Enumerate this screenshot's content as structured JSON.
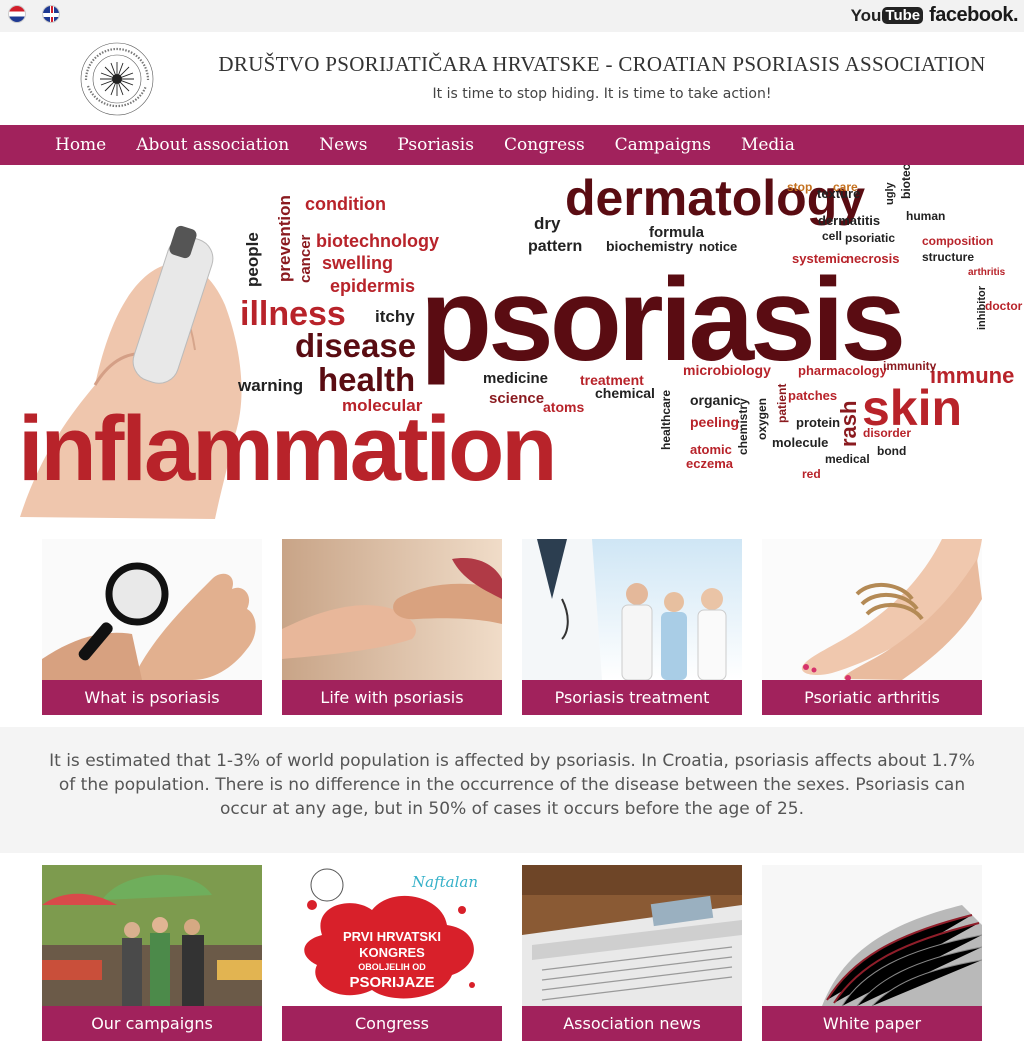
{
  "topbar": {
    "languages": [
      "Croatian",
      "English"
    ],
    "youtube_you": "You",
    "youtube_tube": "Tube",
    "facebook": "facebook."
  },
  "header": {
    "title": "DRUŠTVO PSORIJATIČARA HRVATSKE - CROATIAN PSORIASIS ASSOCIATION",
    "tagline": "It is time to stop hiding. It is time to take action!"
  },
  "nav": {
    "items": [
      "Home",
      "About association",
      "News",
      "Psoriasis",
      "Congress",
      "Campaigns",
      "Media"
    ]
  },
  "hero": {
    "words": {
      "dermatology": "dermatology",
      "psoriasis": "psoriasis",
      "inflammation": "inflammation",
      "skin": "skin",
      "health": "health",
      "disease": "disease",
      "illness": "illness",
      "condition": "condition",
      "biotechnology": "biotechnology",
      "swelling": "swelling",
      "epidermis": "epidermis",
      "itchy": "itchy",
      "warning": "warning",
      "molecular": "molecular",
      "people": "people",
      "prevention": "prevention",
      "cancer": "cancer",
      "dry": "dry",
      "pattern": "pattern",
      "formula": "formula",
      "biochemistry": "biochemistry",
      "notice": "notice",
      "stop": "stop",
      "care": "care",
      "texture": "texture",
      "dermatitis": "dermatitis",
      "cell": "cell",
      "psoriatic": "psoriatic",
      "ugly": "ugly",
      "biotech": "biotech",
      "human": "human",
      "composition": "composition",
      "structure": "structure",
      "systemic": "systemic",
      "necrosis": "necrosis",
      "arthritis": "arthritis",
      "inhibitor": "inhibitor",
      "doctor": "doctor",
      "medicine": "medicine",
      "science": "science",
      "treatment": "treatment",
      "chemical": "chemical",
      "atoms": "atoms",
      "healthcare": "healthcare",
      "microbiology": "microbiology",
      "pharmacology": "pharmacology",
      "immunity": "immunity",
      "immune": "immune",
      "organic": "organic",
      "peeling": "peeling",
      "chemistry": "chemistry",
      "oxygen": "oxygen",
      "patient": "patient",
      "patches": "patches",
      "protein": "protein",
      "molecule": "molecule",
      "rash": "rash",
      "disorder": "disorder",
      "bond": "bond",
      "atomic": "atomic",
      "eczema": "eczema",
      "medical": "medical",
      "red": "red"
    }
  },
  "cards_top": [
    {
      "label": "What is psoriasis"
    },
    {
      "label": "Life with psoriasis"
    },
    {
      "label": "Psoriasis treatment"
    },
    {
      "label": "Psoriatic arthritis"
    }
  ],
  "info": {
    "text": "It is estimated that 1-3% of world population is affected by psoriasis. In Croatia, psoriasis affects about 1.7% of the population. There is no difference in the occurrence of the disease between the sexes. Psoriasis can occur at any age, but in 50% of cases it occurs before the age of 25."
  },
  "cards_bottom": [
    {
      "label": "Our campaigns"
    },
    {
      "label": "Congress",
      "image_text_1": "PRVI HRVATSKI",
      "image_text_2": "KONGRES",
      "image_text_3": "OBOLJELIH OD",
      "image_text_4": "PSORIJAZE",
      "image_brand": "Naftalan"
    },
    {
      "label": "Association news"
    },
    {
      "label": "White paper"
    }
  ],
  "colors": {
    "accent": "#a1225c",
    "dark_red": "#5a0c12",
    "red": "#b8232a"
  }
}
